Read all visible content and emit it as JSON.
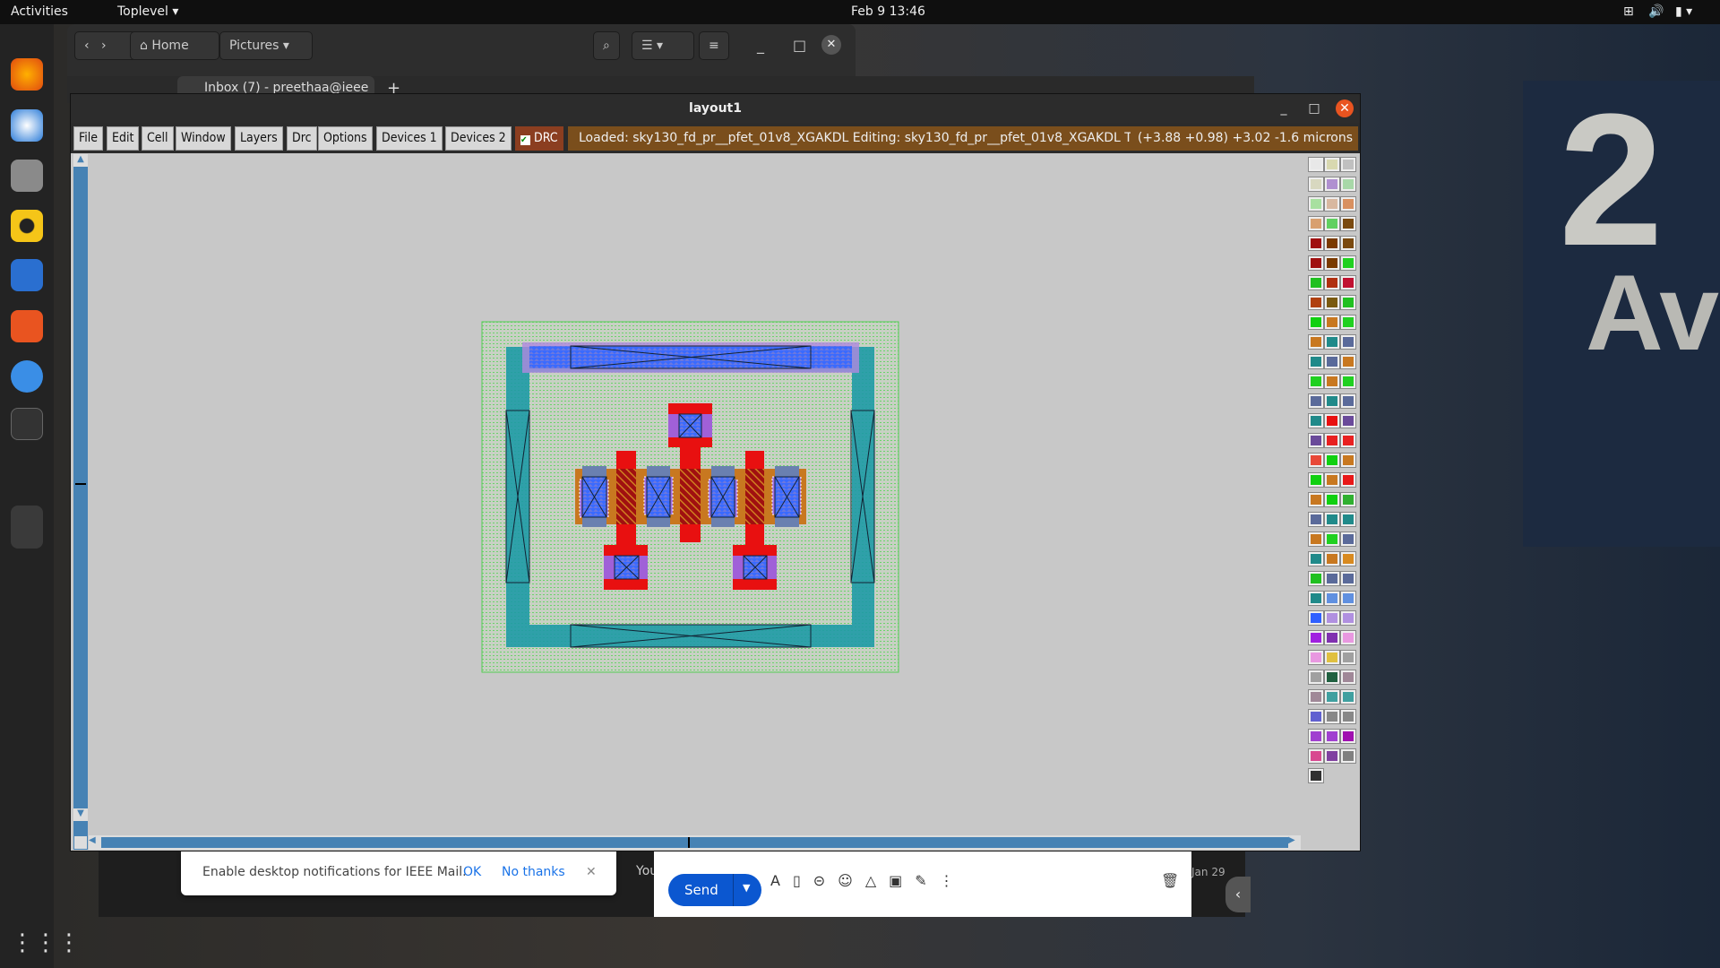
{
  "topbar": {
    "activities": "Activities",
    "app_menu": "Toplevel ▾",
    "clock": "Feb 9  13:46"
  },
  "wallpaper_sign": {
    "number": "2",
    "word": "Ave"
  },
  "files_window": {
    "home": "Home",
    "pictures": "Pictures"
  },
  "browser": {
    "tab_title": "Inbox (7) - preethaa@ieee",
    "new_tab": "+"
  },
  "layout_window": {
    "title": "layout1",
    "menu": [
      "File",
      "Edit",
      "Cell",
      "Window",
      "Layers",
      "Drc",
      "Options",
      "Devices 1",
      "Devices 2"
    ],
    "drc_toggle": "DRC",
    "drc_checked": true,
    "status": "Loaded: sky130_fd_pr__pfet_01v8_XGAKDL Editing: sky130_fd_pr__pfet_01v8_XGAKDL Tool: box",
    "coords": "(+3.88 +0.98) +3.02 -1.6 microns"
  },
  "palette_colors": [
    "#e8e8e8",
    "#d8d8b0",
    "#c0c0c0",
    "#d8d8c0",
    "#b090d0",
    "#a8d8a8",
    "#a8e0a0",
    "#d8b8a0",
    "#d89060",
    "#d8a070",
    "#60d060",
    "#7a4a10",
    "#a01010",
    "#7a3a00",
    "#7a4a10",
    "#a01010",
    "#7a3a00",
    "#20d020",
    "#20c020",
    "#b03010",
    "#c01030",
    "#b04010",
    "#7a5a10",
    "#20c020",
    "#10d010",
    "#c87820",
    "#20d020",
    "#c87820",
    "#208a8a",
    "#5a6a9a",
    "#208a8a",
    "#5a6a9a",
    "#c87820",
    "#20d020",
    "#c87820",
    "#20d020",
    "#5a6a9a",
    "#208a8a",
    "#5a6a9a",
    "#208a8a",
    "#e81010",
    "#6a4a9a",
    "#6a4a9a",
    "#e82020",
    "#e82020",
    "#e84838",
    "#10d010",
    "#c87820",
    "#10d010",
    "#c87820",
    "#e81818",
    "#c87820",
    "#10d010",
    "#30b030",
    "#5a6a9a",
    "#208a8a",
    "#208a8a",
    "#c87820",
    "#20d020",
    "#5a6a9a",
    "#208a8a",
    "#c87820",
    "#d88a20",
    "#20c020",
    "#5a6a9a",
    "#5a6a9a",
    "#208a8a",
    "#6090e0",
    "#6090e0",
    "#3060ff",
    "#b090e0",
    "#b090e0",
    "#a020e0",
    "#8030b0",
    "#e898e0",
    "#e898e0",
    "#e0c040",
    "#a0a0a0",
    "#a0a0a0",
    "#206040",
    "#a08898",
    "#a08898",
    "#40a0a0",
    "#40a0a0",
    "#6060d0",
    "#888888",
    "#888888",
    "#a040d0",
    "#a040d0",
    "#a010b0",
    "#d84890",
    "#8040a0",
    "#808080",
    "#303030"
  ],
  "gmail": {
    "notification": "Enable desktop notifications for IEEE Mail.",
    "ok": "OK",
    "no_thanks": "No thanks",
    "send": "Send",
    "behind_text": "You",
    "date": "Jan 29"
  }
}
